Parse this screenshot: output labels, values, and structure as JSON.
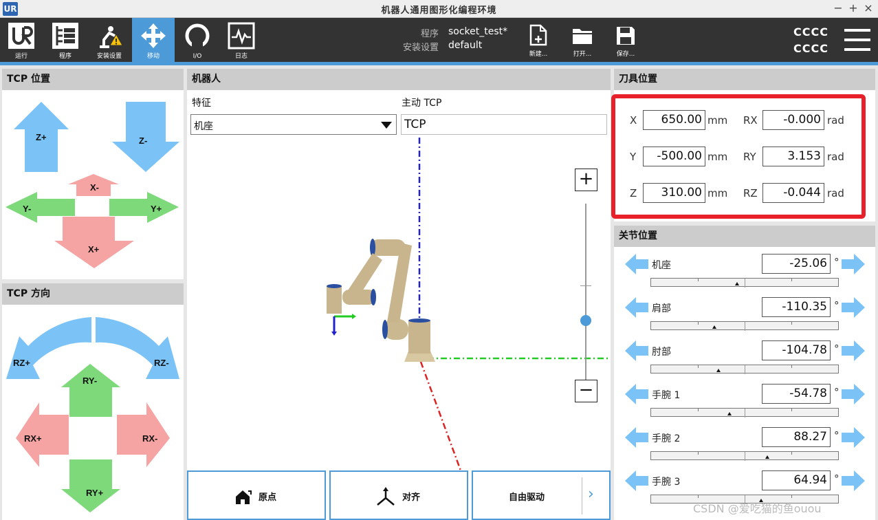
{
  "window": {
    "title": "机器人通用图形化编程环境",
    "controls": [
      "−",
      "+",
      "×"
    ],
    "logo": "UR"
  },
  "toolbar": {
    "tabs": [
      {
        "label": "运行",
        "icon": "ur-logo-icon"
      },
      {
        "label": "程序",
        "icon": "program-tree-icon"
      },
      {
        "label": "安装设置",
        "icon": "robot-warning-icon"
      },
      {
        "label": "移动",
        "icon": "move-arrows-icon"
      },
      {
        "label": "I/O",
        "icon": "io-icon"
      },
      {
        "label": "日志",
        "icon": "log-pulse-icon"
      }
    ],
    "program_label": "程序",
    "program_value": "socket_test*",
    "install_label": "安装设置",
    "install_value": "default",
    "file_buttons": [
      {
        "label": "新建...",
        "icon": "new-file-icon"
      },
      {
        "label": "打开...",
        "icon": "open-folder-icon"
      },
      {
        "label": "保存...",
        "icon": "save-disk-icon"
      }
    ],
    "user_line1": "CCCC",
    "user_line2": "CCCC"
  },
  "tcp_position": {
    "title": "TCP 位置",
    "z_plus": "Z+",
    "z_minus": "Z-",
    "x_minus": "X-",
    "y_minus": "Y-",
    "y_plus": "Y+",
    "x_plus": "X+"
  },
  "tcp_orientation": {
    "title": "TCP 方向",
    "rz_plus": "RZ+",
    "rz_minus": "RZ-",
    "ry_minus": "RY-",
    "rx_plus": "RX+",
    "rx_minus": "RX-",
    "ry_plus": "RY+"
  },
  "robot": {
    "title": "机器人",
    "feature_label": "特征",
    "feature_value": "机座",
    "tcp_label": "主动 TCP",
    "tcp_value": "TCP",
    "zoom_in": "+",
    "zoom_out": "−",
    "home_button": "原点",
    "align_button": "对齐",
    "freedrive_button": "自由驱动",
    "chevron": "›"
  },
  "tool_position": {
    "title": "刀具位置",
    "x": {
      "label": "X",
      "value": "650.00",
      "unit": "mm"
    },
    "y": {
      "label": "Y",
      "value": "-500.00",
      "unit": "mm"
    },
    "z": {
      "label": "Z",
      "value": "310.00",
      "unit": "mm"
    },
    "rx": {
      "label": "RX",
      "value": "-0.000",
      "unit": "rad"
    },
    "ry": {
      "label": "RY",
      "value": "3.153",
      "unit": "rad"
    },
    "rz": {
      "label": "RZ",
      "value": "-0.044",
      "unit": "rad"
    },
    "highlight_color": "#e8202a"
  },
  "joint_position": {
    "title": "关节位置",
    "unit": "°",
    "joints": [
      {
        "name": "机座",
        "value": "-25.06",
        "level": 0.46
      },
      {
        "name": "肩部",
        "value": "-110.35",
        "level": 0.34
      },
      {
        "name": "肘部",
        "value": "-104.78",
        "level": 0.36
      },
      {
        "name": "手腕 1",
        "value": "-54.78",
        "level": 0.42
      },
      {
        "name": "手腕 2",
        "value": "88.27",
        "level": 0.62
      },
      {
        "name": "手腕 3",
        "value": "64.94",
        "level": 0.59
      }
    ]
  },
  "watermark": "CSDN @爱吃猫的鱼ouou"
}
